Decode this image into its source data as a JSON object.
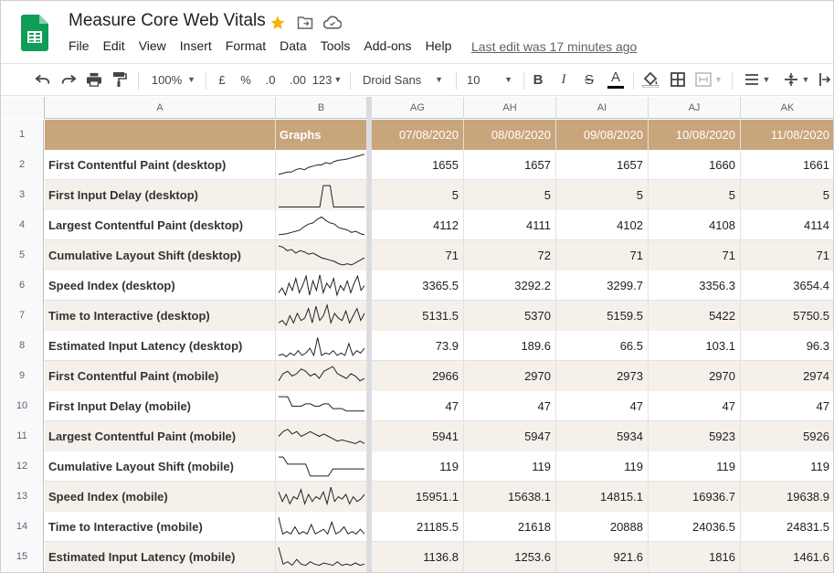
{
  "document": {
    "title": "Measure Core Web Vitals",
    "last_edit": "Last edit was 17 minutes ago"
  },
  "menu": [
    "File",
    "Edit",
    "View",
    "Insert",
    "Format",
    "Data",
    "Tools",
    "Add-ons",
    "Help"
  ],
  "toolbar": {
    "zoom": "100%",
    "currency": "£",
    "percent": "%",
    "decimal_less": ".0",
    "decimal_more": ".00",
    "more_formats": "123",
    "font": "Droid Sans",
    "font_size": "10"
  },
  "colors": {
    "brand_green": "#0f9d58",
    "header_fill": "#c9a57c",
    "alt_row_fill": "#f6f0ea",
    "star": "#f4b400"
  },
  "columns": [
    "A",
    "B",
    "AG",
    "AH",
    "AI",
    "AJ",
    "AK"
  ],
  "header_row": {
    "num": "1",
    "a": "",
    "b": "Graphs",
    "dates": [
      "07/08/2020",
      "08/08/2020",
      "09/08/2020",
      "10/08/2020",
      "11/08/2020"
    ]
  },
  "rows": [
    {
      "num": "2",
      "label": "First Contentful Paint (desktop)",
      "values": [
        "1655",
        "1657",
        "1657",
        "1660",
        "1661"
      ],
      "spark": [
        0.1,
        0.15,
        0.2,
        0.2,
        0.3,
        0.35,
        0.3,
        0.4,
        0.45,
        0.5,
        0.5,
        0.6,
        0.55,
        0.65,
        0.7,
        0.72,
        0.75,
        0.8,
        0.85,
        0.9,
        0.95
      ]
    },
    {
      "num": "3",
      "label": "First Input Delay (desktop)",
      "values": [
        "5",
        "5",
        "5",
        "5",
        "5"
      ],
      "spark": [
        0,
        0,
        0,
        0,
        0,
        0,
        0,
        0,
        0,
        0,
        0,
        0,
        0,
        0.9,
        0.9,
        0.9,
        0,
        0,
        0,
        0,
        0,
        0,
        0,
        0,
        0,
        0
      ]
    },
    {
      "num": "4",
      "label": "Largest Contentful Paint (desktop)",
      "values": [
        "4112",
        "4111",
        "4102",
        "4108",
        "4114"
      ],
      "spark": [
        0.1,
        0.12,
        0.15,
        0.2,
        0.25,
        0.3,
        0.45,
        0.55,
        0.6,
        0.75,
        0.85,
        0.7,
        0.6,
        0.55,
        0.4,
        0.35,
        0.3,
        0.2,
        0.25,
        0.15,
        0.1
      ]
    },
    {
      "num": "5",
      "label": "Cumulative Layout Shift (desktop)",
      "values": [
        "71",
        "72",
        "71",
        "71",
        "71"
      ],
      "spark": [
        0.9,
        0.85,
        0.7,
        0.75,
        0.6,
        0.7,
        0.65,
        0.55,
        0.6,
        0.5,
        0.4,
        0.35,
        0.3,
        0.25,
        0.15,
        0.1,
        0.15,
        0.1,
        0.2,
        0.3,
        0.4
      ]
    },
    {
      "num": "6",
      "label": "Speed Index (desktop)",
      "values": [
        "3365.5",
        "3292.2",
        "3299.7",
        "3356.3",
        "3654.4"
      ],
      "spark": [
        0.2,
        0.4,
        0.1,
        0.6,
        0.3,
        0.8,
        0.2,
        0.5,
        0.9,
        0.1,
        0.7,
        0.3,
        0.95,
        0.2,
        0.6,
        0.4,
        0.8,
        0.1,
        0.5,
        0.3,
        0.7,
        0.2,
        0.6,
        0.9,
        0.3,
        0.5
      ]
    },
    {
      "num": "7",
      "label": "Time to Interactive (desktop)",
      "values": [
        "5131.5",
        "5370",
        "5159.5",
        "5422",
        "5750.5"
      ],
      "spark": [
        0.2,
        0.3,
        0.1,
        0.5,
        0.2,
        0.6,
        0.3,
        0.4,
        0.8,
        0.2,
        0.9,
        0.3,
        0.5,
        0.95,
        0.2,
        0.6,
        0.4,
        0.3,
        0.7,
        0.2,
        0.5,
        0.8,
        0.3,
        0.6
      ]
    },
    {
      "num": "8",
      "label": "Estimated Input Latency (desktop)",
      "values": [
        "73.9",
        "189.6",
        "66.5",
        "103.1",
        "96.3"
      ],
      "spark": [
        0.1,
        0.15,
        0.05,
        0.2,
        0.1,
        0.3,
        0.1,
        0.2,
        0.4,
        0.1,
        0.85,
        0.1,
        0.2,
        0.15,
        0.3,
        0.1,
        0.2,
        0.1,
        0.6,
        0.1,
        0.3,
        0.2,
        0.4
      ]
    },
    {
      "num": "9",
      "label": "First Contentful Paint (mobile)",
      "values": [
        "2966",
        "2970",
        "2973",
        "2970",
        "2974"
      ],
      "spark": [
        0.3,
        0.6,
        0.7,
        0.5,
        0.6,
        0.8,
        0.7,
        0.5,
        0.6,
        0.4,
        0.7,
        0.8,
        0.9,
        0.6,
        0.5,
        0.4,
        0.6,
        0.5,
        0.3,
        0.4
      ]
    },
    {
      "num": "10",
      "label": "First Input Delay (mobile)",
      "values": [
        "47",
        "47",
        "47",
        "47",
        "47"
      ],
      "spark": [
        0.9,
        0.9,
        0.9,
        0.5,
        0.5,
        0.5,
        0.6,
        0.6,
        0.5,
        0.5,
        0.6,
        0.6,
        0.4,
        0.4,
        0.4,
        0.3,
        0.3,
        0.3,
        0.3,
        0.3
      ]
    },
    {
      "num": "11",
      "label": "Largest Contentful Paint (mobile)",
      "values": [
        "5941",
        "5947",
        "5934",
        "5923",
        "5926"
      ],
      "spark": [
        0.5,
        0.7,
        0.8,
        0.6,
        0.7,
        0.5,
        0.6,
        0.7,
        0.6,
        0.5,
        0.6,
        0.5,
        0.4,
        0.3,
        0.35,
        0.3,
        0.25,
        0.2,
        0.3,
        0.2
      ]
    },
    {
      "num": "12",
      "label": "Cumulative Layout Shift (mobile)",
      "values": [
        "119",
        "119",
        "119",
        "119",
        "119"
      ],
      "spark": [
        0.9,
        0.9,
        0.6,
        0.6,
        0.6,
        0.6,
        0.6,
        0.1,
        0.1,
        0.1,
        0.1,
        0.1,
        0.4,
        0.4,
        0.4,
        0.4,
        0.4,
        0.4,
        0.4,
        0.4
      ]
    },
    {
      "num": "13",
      "label": "Speed Index (mobile)",
      "values": [
        "15951.1",
        "15638.1",
        "14815.1",
        "16936.7",
        "19638.9"
      ],
      "spark": [
        0.7,
        0.3,
        0.6,
        0.2,
        0.5,
        0.4,
        0.8,
        0.2,
        0.6,
        0.3,
        0.5,
        0.4,
        0.7,
        0.2,
        0.9,
        0.3,
        0.5,
        0.4,
        0.6,
        0.2,
        0.5,
        0.3,
        0.4,
        0.6
      ]
    },
    {
      "num": "14",
      "label": "Time to Interactive (mobile)",
      "values": [
        "21185.5",
        "21618",
        "20888",
        "24036.5",
        "24831.5"
      ],
      "spark": [
        0.9,
        0.2,
        0.3,
        0.2,
        0.5,
        0.2,
        0.3,
        0.2,
        0.6,
        0.2,
        0.3,
        0.4,
        0.2,
        0.7,
        0.2,
        0.3,
        0.5,
        0.2,
        0.3,
        0.2,
        0.4,
        0.2
      ]
    },
    {
      "num": "15",
      "label": "Estimated Input Latency (mobile)",
      "values": [
        "1136.8",
        "1253.6",
        "921.6",
        "1816",
        "1461.6"
      ],
      "spark": [
        0.9,
        0.2,
        0.3,
        0.15,
        0.4,
        0.2,
        0.15,
        0.3,
        0.2,
        0.15,
        0.25,
        0.2,
        0.15,
        0.3,
        0.15,
        0.2,
        0.15,
        0.25,
        0.15,
        0.2
      ]
    }
  ]
}
